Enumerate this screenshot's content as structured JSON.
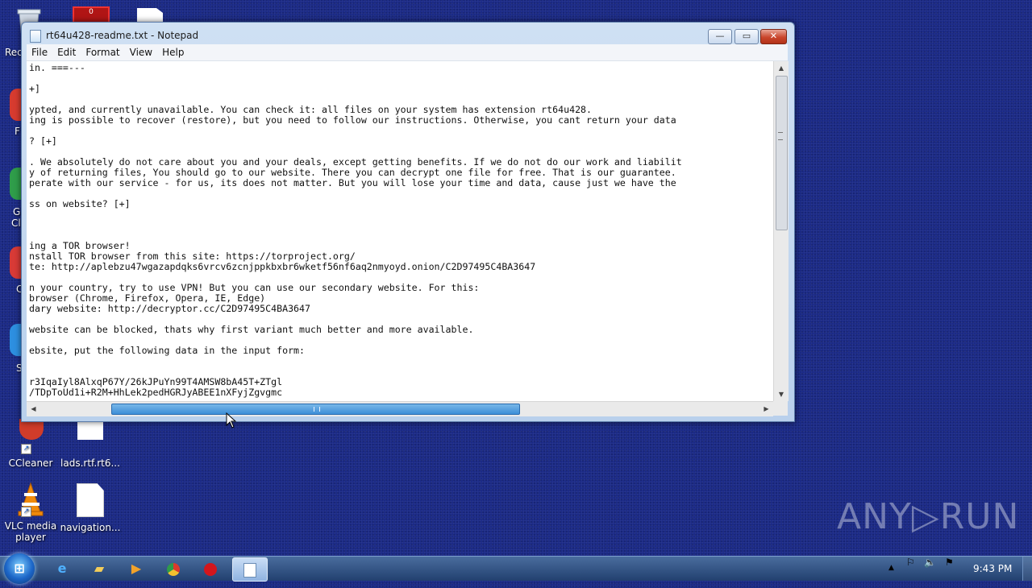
{
  "desktop": {
    "icons": [
      {
        "label": "CCleaner"
      },
      {
        "label": "lads.rtf.rt6..."
      },
      {
        "label": "VLC media player"
      },
      {
        "label": "navigation..."
      }
    ],
    "partial_labels": {
      "recycle": "Rec",
      "a": "F",
      "b": "G",
      "c": "Cl",
      "d": "C",
      "e": "S"
    }
  },
  "window": {
    "title": "rt64u428-readme.txt - Notepad",
    "buttons": {
      "minimize": "—",
      "maximize": "▭",
      "close": "✕"
    },
    "menu": [
      "File",
      "Edit",
      "Format",
      "View",
      "Help"
    ],
    "lines": [
      "in. ===---",
      "",
      "+]",
      "",
      "ypted, and currently unavailable. You can check it: all files on your system has extension rt64u428.",
      "ing is possible to recover (restore), but you need to follow our instructions. Otherwise, you cant return your data",
      "",
      "? [+]",
      "",
      ". We absolutely do not care about you and your deals, except getting benefits. If we do not do our work and liabilit",
      "y of returning files, You should go to our website. There you can decrypt one file for free. That is our guarantee.",
      "perate with our service - for us, its does not matter. But you will lose your time and data, cause just we have the",
      "",
      "ss on website? [+]",
      "",
      "",
      "",
      "ing a TOR browser!",
      "nstall TOR browser from this site: https://torproject.org/",
      "te: http://aplebzu47wgazapdqks6vrcv6zcnjppkbxbr6wketf56nf6aq2nmyoyd.onion/C2D97495C4BA3647",
      "",
      "n your country, try to use VPN! But you can use our secondary website. For this:",
      "browser (Chrome, Firefox, Opera, IE, Edge)",
      "dary website: http://decryptor.cc/C2D97495C4BA3647",
      "",
      "website can be blocked, thats why first variant much better and more available.",
      "",
      "ebsite, put the following data in the input form:",
      "",
      "",
      "r3IqaIyl8AlxqP67Y/26kJPuYn99T4AMSW8bA45T+ZTgl",
      "/TDpToUd1i+R2M+HhLek2pedHGRJyABEE1nXFyjZgvgmc"
    ]
  },
  "taskbar": {
    "clock": "9:43 PM",
    "apps": [
      "internet-explorer",
      "file-explorer",
      "media-player",
      "chrome",
      "opera",
      "notepad"
    ]
  },
  "watermark": {
    "text": "ANY▷RUN"
  }
}
